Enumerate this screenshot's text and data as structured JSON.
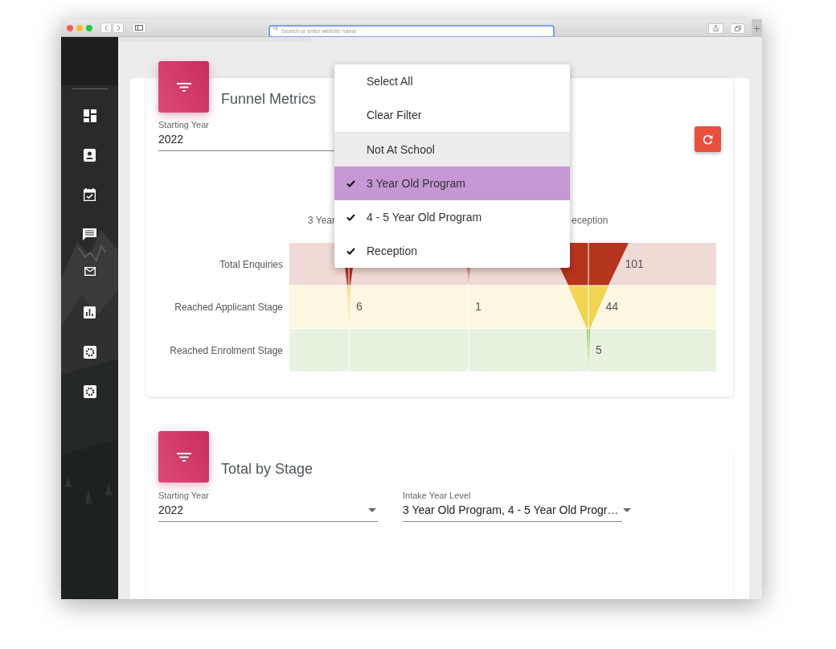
{
  "browser": {
    "address_placeholder": "Search or enter website name"
  },
  "funnel_card": {
    "title": "Funnel Metrics",
    "field": {
      "label": "Starting Year",
      "value": "2022"
    },
    "columns": [
      {
        "kind": "header",
        "label": "3 Year"
      },
      {
        "kind": "blank"
      },
      {
        "kind": "header",
        "label": "eception"
      }
    ],
    "rows": [
      {
        "label": "Total Enquiries",
        "cells": [
          {
            "kind": "blank"
          },
          {
            "kind": "blank"
          },
          {
            "kind": "value",
            "value": "101"
          }
        ]
      },
      {
        "label": "Reached Applicant Stage",
        "cells": [
          {
            "kind": "value",
            "value": "6"
          },
          {
            "kind": "value",
            "value": "1"
          },
          {
            "kind": "value",
            "value": "44"
          }
        ]
      },
      {
        "label": "Reached Enrolment Stage",
        "cells": [
          {
            "kind": "blank"
          },
          {
            "kind": "blank"
          },
          {
            "kind": "value",
            "value": "5"
          }
        ]
      }
    ]
  },
  "menu": {
    "items": [
      {
        "kind": "action",
        "label": "Select All"
      },
      {
        "kind": "action",
        "label": "Clear Filter"
      },
      {
        "kind": "option",
        "label": "Not At School",
        "checked": false,
        "selected": false,
        "highlighted": true
      },
      {
        "kind": "option",
        "label": "3 Year Old Program",
        "checked": true,
        "selected": true,
        "highlighted": false
      },
      {
        "kind": "option",
        "label": "4 - 5 Year Old Program",
        "checked": true,
        "selected": false,
        "highlighted": false
      },
      {
        "kind": "option",
        "label": "Reception",
        "checked": true,
        "selected": false,
        "highlighted": false
      }
    ]
  },
  "stage_card": {
    "title": "Total by Stage",
    "fields": [
      {
        "label": "Starting Year",
        "value": "2022"
      },
      {
        "label": "Intake Year Level",
        "value": "3 Year Old Program, 4 - 5 Year Old Progr…"
      }
    ]
  }
}
